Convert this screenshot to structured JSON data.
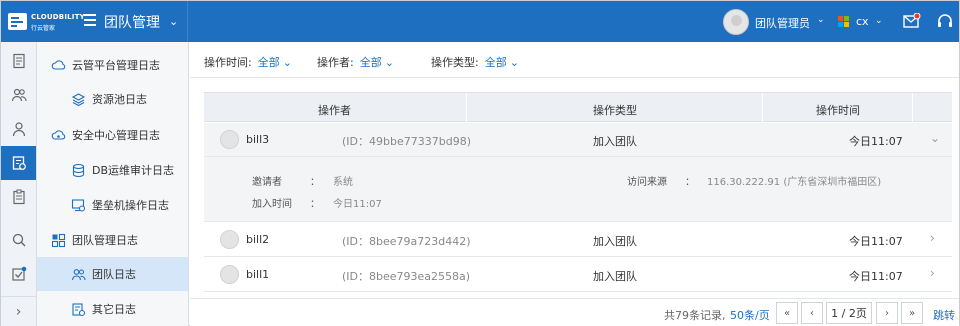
{
  "header": {
    "brand": "CLOUDBILITY",
    "brand_cn": "行云管家",
    "title": "团队管理",
    "user_name": "团队管理员",
    "region": "cx",
    "accent": "#1f6fc1"
  },
  "rail": {
    "icons": [
      "document-icon",
      "users-icon",
      "user-icon",
      "log-icon",
      "clipboard-icon",
      "search-icon",
      "checklist-icon"
    ],
    "expand": "›"
  },
  "sidebar": {
    "items": [
      {
        "label": "云管平台管理日志",
        "icon": "cloud-icon",
        "level": 1
      },
      {
        "label": "资源池日志",
        "icon": "layers-icon",
        "level": 2
      },
      {
        "label": "安全中心管理日志",
        "icon": "cloud-shield-icon",
        "level": 1
      },
      {
        "label": "DB运维审计日志",
        "icon": "database-icon",
        "level": 2
      },
      {
        "label": "堡垒机操作日志",
        "icon": "bastion-icon",
        "level": 2
      },
      {
        "label": "团队管理日志",
        "icon": "grid-icon",
        "level": 1
      },
      {
        "label": "团队日志",
        "icon": "team-icon",
        "level": 2,
        "active": true
      },
      {
        "label": "其它日志",
        "icon": "other-log-icon",
        "level": 2
      }
    ]
  },
  "filters": {
    "time_label": "操作时间:",
    "time_value": "全部",
    "operator_label": "操作者:",
    "operator_value": "全部",
    "type_label": "操作类型:",
    "type_value": "全部"
  },
  "table": {
    "columns": [
      "操作者",
      "操作类型",
      "操作时间"
    ],
    "rows": [
      {
        "name": "bill3",
        "id": "(ID：49bbe77337bd98)",
        "type": "加入团队",
        "time": "今日11:07",
        "expanded": true
      },
      {
        "name": "bill2",
        "id": "(ID：8bee79a723d442)",
        "type": "加入团队",
        "time": "今日11:07"
      },
      {
        "name": "bill1",
        "id": "(ID：8bee793ea2558a)",
        "type": "加入团队",
        "time": "今日11:07"
      }
    ],
    "detail": {
      "inviter_label": "邀请者",
      "inviter_value": "系统",
      "join_time_label": "加入时间",
      "join_time_value": "今日11:07",
      "source_label": "访问来源",
      "source_value": "116.30.222.91 (广东省深圳市福田区)",
      "colon": "："
    }
  },
  "pager": {
    "total": "共79条记录,",
    "page_size": "50条/页",
    "first": "«",
    "prev": "‹",
    "pages": "1 / 2页",
    "next": "›",
    "last": "»",
    "jump": "跳转"
  }
}
